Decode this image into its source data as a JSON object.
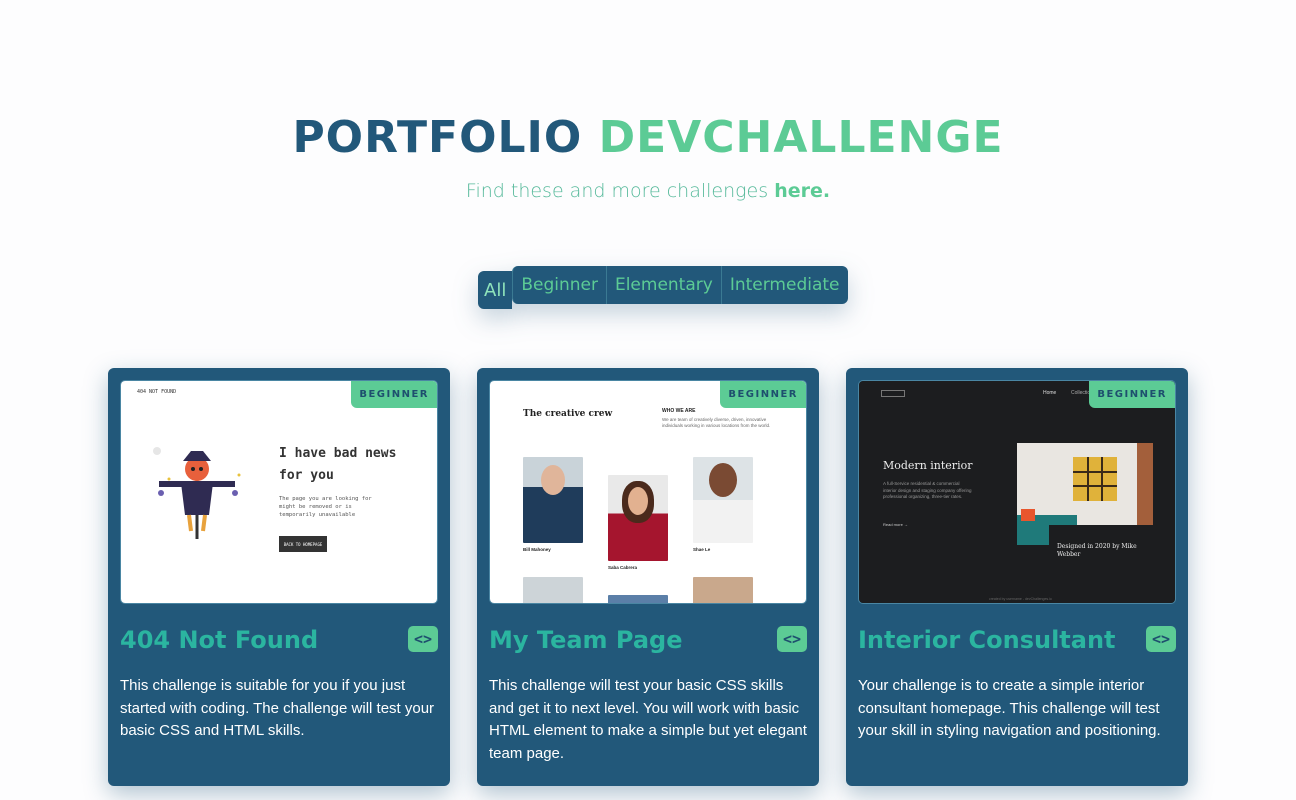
{
  "header": {
    "title_part1": "PORTFOLIO",
    "title_part2": "DEVCHALLENGE",
    "subtitle": "Find these and more challenges",
    "subtitle_link": "here."
  },
  "filters": [
    "All",
    "Beginner",
    "Elementary",
    "Intermediate"
  ],
  "cards": [
    {
      "badge": "BEGINNER",
      "title": "404 Not Found",
      "code_icon": "<>",
      "description": "This challenge is suitable for you if you just started with coding. The challenge will test your basic CSS and HTML skills.",
      "preview": {
        "brand": "404 NOT FOUND",
        "heading": "I have bad news for you",
        "body": "The page you are looking for might be removed or is temporarily unavailable",
        "button": "BACK TO HOMEPAGE"
      }
    },
    {
      "badge": "BEGINNER",
      "title": "My Team Page",
      "code_icon": "<>",
      "description": "This challenge will test your basic CSS skills and get it to next level. You will work with basic HTML element to make a simple but yet elegant team page.",
      "preview": {
        "heading": "The creative crew",
        "who_title": "WHO WE ARE",
        "who_text": "We are team of creatively diverse, driven, innovative individuals working in various locations from the world.",
        "names": [
          "Bill Mahoney",
          "Saba Cabrera",
          "Shae Le"
        ]
      }
    },
    {
      "badge": "BEGINNER",
      "title": "Interior Consultant",
      "code_icon": "<>",
      "description": "Your challenge is to create a simple interior consultant homepage. This challenge will test your skill in styling navigation and positioning.",
      "preview": {
        "nav1": "Home",
        "nav2": "Collection",
        "heading": "Modern interior",
        "text": "A full-Service residential & commercial interior design and staging company offering professional organizing, three-tier rates.",
        "more": "Read more →",
        "caption": "Designed in 2020 by Mike Webber",
        "footer": "created by username - devChallenges.io"
      }
    }
  ]
}
